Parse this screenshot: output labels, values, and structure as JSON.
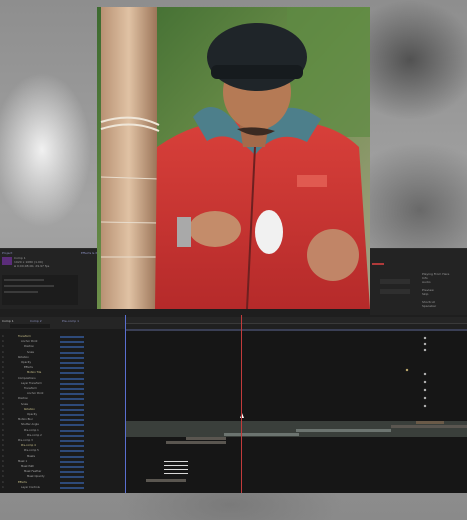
{
  "project_panel": {
    "tab_label": "Project",
    "lines": [
      "Comp 1",
      "1920 x 1080 (1.00)",
      "Δ 0;00;08;00, 29.97 fps"
    ]
  },
  "effects_panel": {
    "tab_label": "Effects & Presets"
  },
  "right_panel": {
    "lines": [
      "Playing From Here",
      "Info",
      "Audio",
      "Preview",
      "Skip",
      "Shortcut",
      "Spacebar"
    ]
  },
  "timeline": {
    "tabs": [
      "Comp 1",
      "Comp 2",
      "Pre-comp 1"
    ],
    "search_placeholder": "",
    "layer_rows": [
      "Transform",
      "Anchor Point",
      "Position",
      "Scale",
      "Rotation",
      "Opacity",
      "Effects",
      "Motion Tile",
      "Compositions",
      "Layer Transform",
      "Transform",
      "Anchor Point",
      "Position",
      "Scale",
      "Rotation",
      "Opacity",
      "Motion Blur",
      "Shutter Angle",
      "Pre-comp 1",
      "Pre-comp 2",
      "Pre-comp 3",
      "Pre-comp 4",
      "Pre-comp 5",
      "Masks",
      "Mask 1",
      "Mask Path",
      "Mask Feather",
      "Mask Opacity",
      "Effects",
      "Layer Controls"
    ]
  },
  "colors": {
    "accent": "#5a6fd0",
    "playhead": "#c23b3b",
    "panel_bg": "#1e1e1e"
  }
}
